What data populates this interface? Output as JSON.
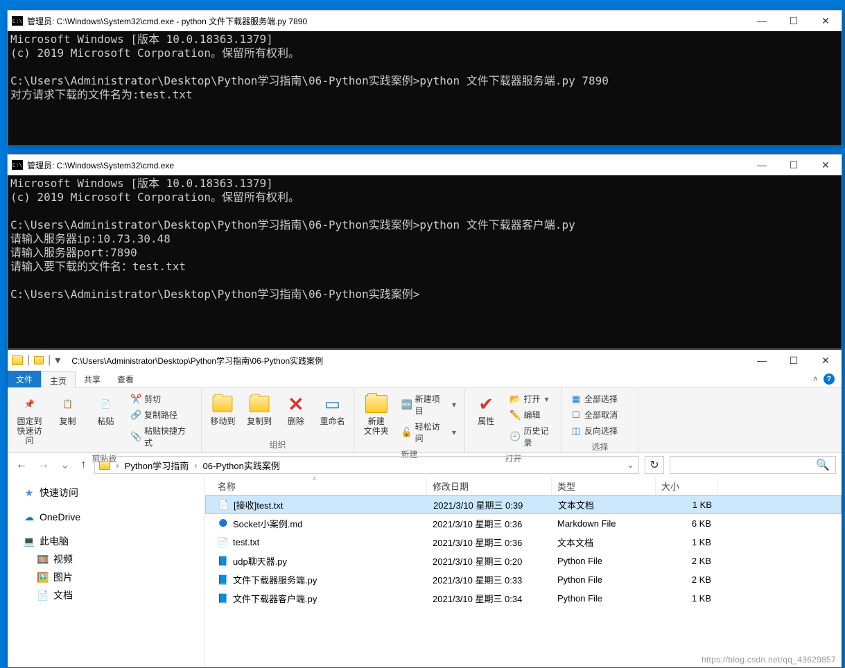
{
  "cmd1": {
    "title": "管理员: C:\\Windows\\System32\\cmd.exe - python  文件下载器服务端.py 7890",
    "body": "Microsoft Windows [版本 10.0.18363.1379]\n(c) 2019 Microsoft Corporation。保留所有权利。\n\nC:\\Users\\Administrator\\Desktop\\Python学习指南\\06-Python实践案例>python 文件下载器服务端.py 7890\n对方请求下载的文件名为:test.txt\n"
  },
  "cmd2": {
    "title": "管理员: C:\\Windows\\System32\\cmd.exe",
    "body": "Microsoft Windows [版本 10.0.18363.1379]\n(c) 2019 Microsoft Corporation。保留所有权利。\n\nC:\\Users\\Administrator\\Desktop\\Python学习指南\\06-Python实践案例>python 文件下载器客户端.py\n请输入服务器ip:10.73.30.48\n请输入服务器port:7890\n请输入要下载的文件名：test.txt\n\nC:\\Users\\Administrator\\Desktop\\Python学习指南\\06-Python实践案例>"
  },
  "explorer": {
    "path": "C:\\Users\\Administrator\\Desktop\\Python学习指南\\06-Python实践案例",
    "tabs": {
      "file": "文件",
      "home": "主页",
      "share": "共享",
      "view": "查看"
    },
    "ribbon": {
      "clipboard": {
        "label": "剪贴板",
        "pin": "固定到快速访问",
        "copy": "复制",
        "paste": "粘贴",
        "cut": "剪切",
        "copypath": "复制路径",
        "pasteshortcut": "粘贴快捷方式"
      },
      "organize": {
        "label": "组织",
        "moveto": "移动到",
        "copyto": "复制到",
        "delete": "删除",
        "rename": "重命名"
      },
      "new": {
        "label": "新建",
        "newfolder": "新建\n文件夹",
        "newitem": "新建项目",
        "easyaccess": "轻松访问"
      },
      "open": {
        "label": "打开",
        "properties": "属性",
        "open": "打开",
        "edit": "编辑",
        "history": "历史记录"
      },
      "select": {
        "label": "选择",
        "selectall": "全部选择",
        "selectnone": "全部取消",
        "invert": "反向选择"
      }
    },
    "breadcrumb": {
      "a": "Python学习指南",
      "b": "06-Python实践案例"
    },
    "columns": {
      "name": "名称",
      "date": "修改日期",
      "type": "类型",
      "size": "大小"
    },
    "tree": {
      "quick": "快速访问",
      "onedrive": "OneDrive",
      "thispc": "此电脑",
      "videos": "视频",
      "pictures": "图片",
      "documents": "文档"
    },
    "files": [
      {
        "name": "[接收]test.txt",
        "date": "2021/3/10 星期三 0:39",
        "type": "文本文档",
        "size": "1 KB",
        "icon": "txt",
        "selected": true
      },
      {
        "name": "Socket小案例.md",
        "date": "2021/3/10 星期三 0:36",
        "type": "Markdown File",
        "size": "6 KB",
        "icon": "md"
      },
      {
        "name": "test.txt",
        "date": "2021/3/10 星期三 0:36",
        "type": "文本文档",
        "size": "1 KB",
        "icon": "txt"
      },
      {
        "name": "udp聊天器.py",
        "date": "2021/3/10 星期三 0:20",
        "type": "Python File",
        "size": "2 KB",
        "icon": "py"
      },
      {
        "name": "文件下载器服务端.py",
        "date": "2021/3/10 星期三 0:33",
        "type": "Python File",
        "size": "2 KB",
        "icon": "py"
      },
      {
        "name": "文件下载器客户端.py",
        "date": "2021/3/10 星期三 0:34",
        "type": "Python File",
        "size": "1 KB",
        "icon": "py"
      }
    ]
  },
  "watermark": "https://blog.csdn.net/qq_43629857",
  "icons": {
    "cmd": "C:\\",
    "min": "—",
    "max": "☐",
    "close": "✕",
    "dropdown": "▾",
    "divider": "|",
    "chevron": "›",
    "down": "⌄",
    "up": "˄",
    "refresh": "↻",
    "search": "🔍"
  }
}
